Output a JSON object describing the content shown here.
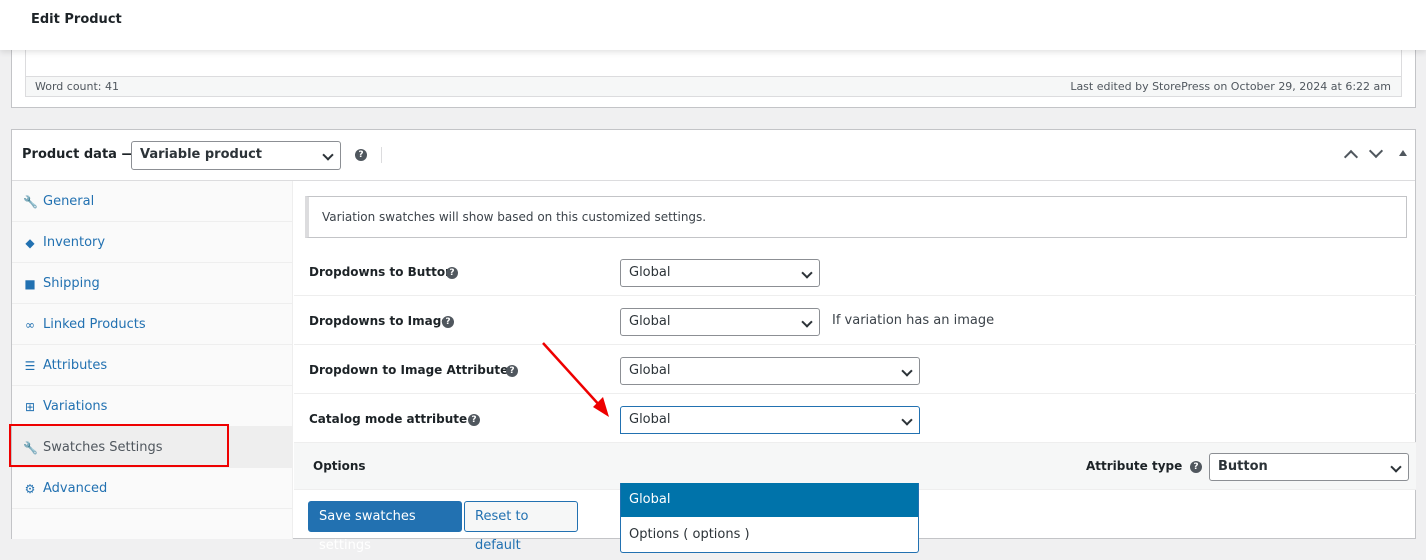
{
  "header": {
    "title": "Edit Product"
  },
  "editor": {
    "word_count": "Word count: 41",
    "last_edited": "Last edited by StorePress on October 29, 2024 at 6:22 am"
  },
  "product_data": {
    "title": "Product data —",
    "type": "Variable product",
    "help": "?"
  },
  "tabs": [
    {
      "label": "General",
      "icon": "wrench-icon"
    },
    {
      "label": "Inventory",
      "icon": "tag-icon"
    },
    {
      "label": "Shipping",
      "icon": "truck-icon"
    },
    {
      "label": "Linked Products",
      "icon": "link-icon"
    },
    {
      "label": "Attributes",
      "icon": "list-icon"
    },
    {
      "label": "Variations",
      "icon": "grid-icon"
    },
    {
      "label": "Swatches Settings",
      "icon": "wrench-icon",
      "active": true
    },
    {
      "label": "Advanced",
      "icon": "gear-icon"
    }
  ],
  "panel": {
    "notice": "Variation swatches will show based on this customized settings.",
    "rows": [
      {
        "label": "Dropdowns to Button",
        "value": "Global",
        "hint": ""
      },
      {
        "label": "Dropdowns to Image",
        "value": "Global",
        "hint": "If variation has an image"
      },
      {
        "label": "Dropdown to Image Attribute",
        "value": "Global",
        "hint": ""
      },
      {
        "label": "Catalog mode attribute",
        "value": "Global",
        "hint": ""
      }
    ],
    "dropdown_options": [
      "Global",
      "Options ( options )"
    ],
    "options_label": "Options",
    "attribute_type_label": "Attribute type",
    "attribute_type_value": "Button",
    "save_label": "Save swatches settings",
    "reset_label": "Reset to default"
  },
  "colors": {
    "accent": "#2271b1",
    "highlight": "#0073aa",
    "annotation": "#ee0000"
  }
}
